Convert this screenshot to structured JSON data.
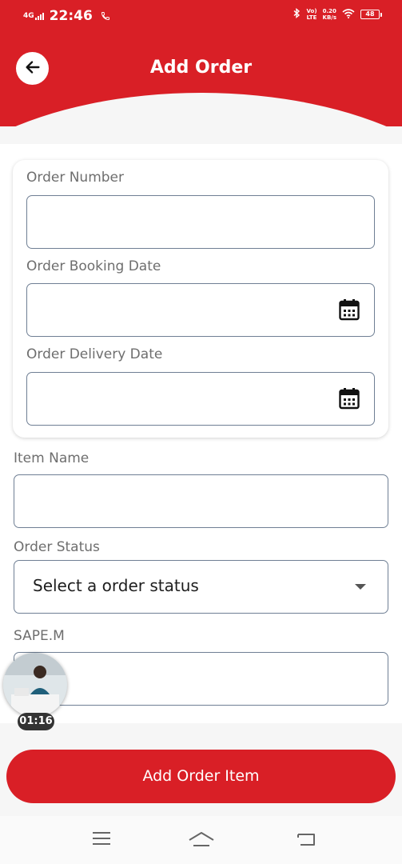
{
  "status_bar": {
    "network": "4G",
    "time": "22:46",
    "volte_line1": "Vo)",
    "volte_line2": "LTE",
    "speed_value": "0.20",
    "speed_unit": "KB/s",
    "battery": "48",
    "icons": [
      "signal-icon",
      "call-icon",
      "bluetooth-icon",
      "wifi-icon",
      "battery-icon"
    ]
  },
  "header": {
    "title": "Add Order",
    "back_icon": "arrow-left-icon"
  },
  "form": {
    "order_number": {
      "label": "Order Number",
      "value": ""
    },
    "order_booking_date": {
      "label": "Order Booking Date",
      "value": "",
      "icon": "calendar-icon"
    },
    "order_delivery_date": {
      "label": "Order Delivery Date",
      "value": "",
      "icon": "calendar-icon"
    },
    "item_name": {
      "label": "Item Name",
      "value": ""
    },
    "order_status": {
      "label": "Order Status",
      "selected": "Select a order status",
      "icon": "chevron-down-icon"
    },
    "sape_m": {
      "label": "SAPE.M",
      "value": ""
    }
  },
  "overlay": {
    "timer": "01:16"
  },
  "actions": {
    "add_order_item": "Add Order Item"
  },
  "nav_bar": {
    "icons": [
      "menu-icon",
      "home-icon",
      "back-icon"
    ]
  },
  "colors": {
    "primary": "#d91f26",
    "input_border": "#6f7f94",
    "label": "#6e6e6e"
  }
}
